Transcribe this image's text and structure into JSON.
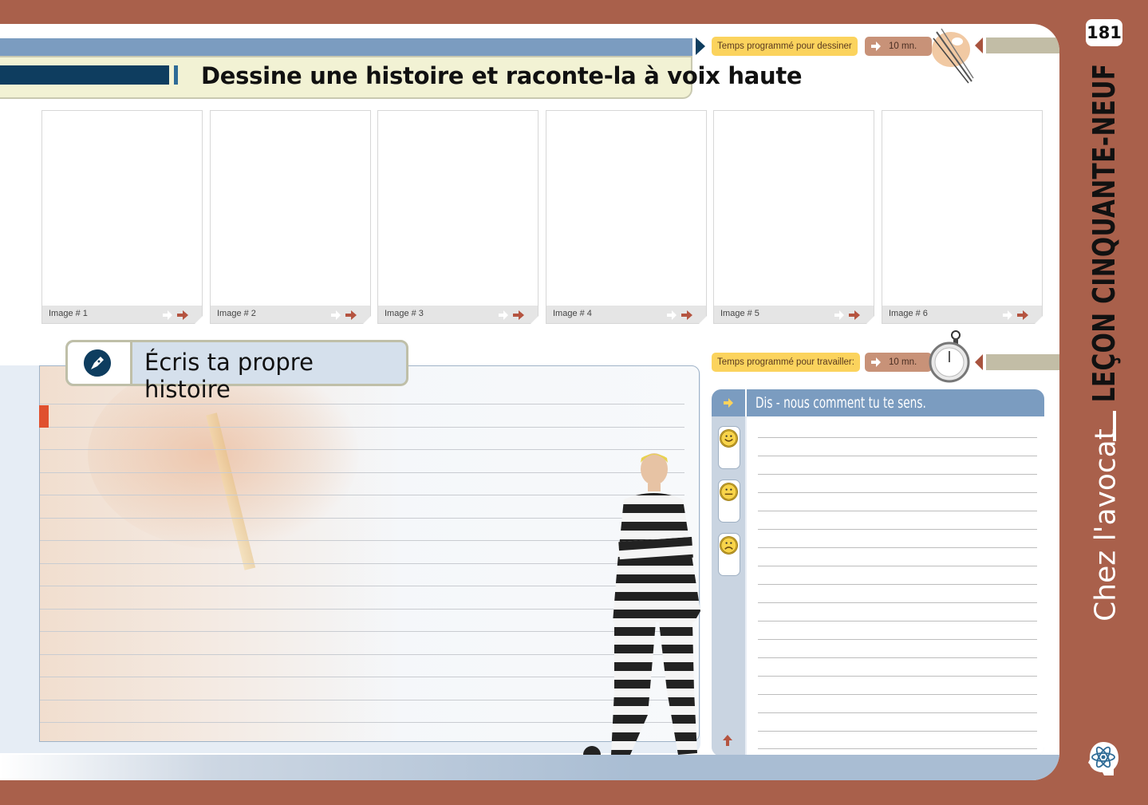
{
  "header": {
    "title": "Dessine une histoire et raconte-la à voix haute"
  },
  "drawing_timer": {
    "label": "Temps programmé pour dessiner",
    "value": "10 mn.",
    "icon": "palette-brushes-icon"
  },
  "work_timer": {
    "label": "Temps programmé pour travailler:",
    "value": "10 mn.",
    "icon": "stopwatch-icon"
  },
  "frames": [
    {
      "label": "Image # 1"
    },
    {
      "label": "Image # 2"
    },
    {
      "label": "Image # 3"
    },
    {
      "label": "Image # 4"
    },
    {
      "label": "Image # 5"
    },
    {
      "label": "Image # 6"
    }
  ],
  "write_section": {
    "title": "Écris ta propre histoire",
    "icon": "pen-icon"
  },
  "feelings": {
    "title": "Dis - nous comment tu te sens.",
    "faces": [
      "happy-face-icon",
      "neutral-face-icon",
      "sad-face-icon"
    ]
  },
  "side": {
    "page_number": "181",
    "lesson": "LEÇON CINQUANTE-NEUF",
    "topic": "Chez l'avocat",
    "icon": "brain-atom-icon"
  },
  "colors": {
    "border": "#a9604b",
    "header_blue": "#7b9cc0",
    "navy": "#0e3d5f",
    "timer_yellow": "#fbd35d",
    "timer_tan": "#c89278"
  }
}
